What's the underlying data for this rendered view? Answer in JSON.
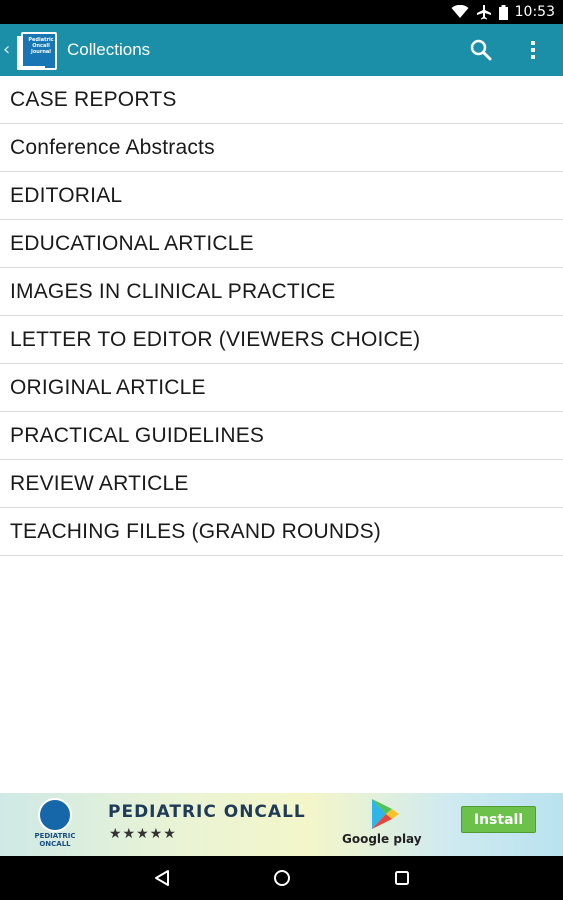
{
  "status_bar": {
    "time": "10:53",
    "icons": [
      "wifi-icon",
      "airplane-icon",
      "battery-icon"
    ]
  },
  "action_bar": {
    "title": "Collections",
    "logo_text": [
      "Pediatric",
      "Oncall",
      "Journal"
    ],
    "color": "#1b8fa8",
    "icons": [
      "search-icon",
      "overflow-menu-icon"
    ]
  },
  "collections": [
    "CASE REPORTS",
    "Conference Abstracts",
    "EDITORIAL",
    "EDUCATIONAL ARTICLE",
    "IMAGES IN CLINICAL PRACTICE",
    "LETTER TO EDITOR (VIEWERS CHOICE)",
    "ORIGINAL ARTICLE",
    "PRACTICAL GUIDELINES",
    "REVIEW ARTICLE",
    "TEACHING FILES (GRAND ROUNDS)"
  ],
  "ad": {
    "logo_text": [
      "PEDIATRIC",
      "ONCALL"
    ],
    "name": "PEDIATRIC ONCALL",
    "stars": "★★★★★",
    "store_label": "Google play",
    "install_label": "Install",
    "install_color": "#6cc14a"
  },
  "nav_bar": {
    "icons": [
      "back-icon",
      "home-icon",
      "recents-icon"
    ]
  }
}
